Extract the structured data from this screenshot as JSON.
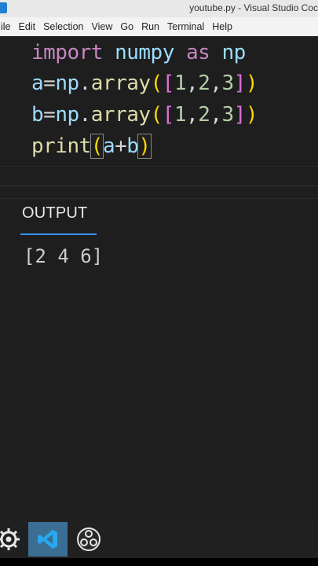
{
  "window": {
    "title": "youtube.py - Visual Studio Coc"
  },
  "menu": [
    {
      "label": "ile"
    },
    {
      "label": "Edit"
    },
    {
      "label": "Selection"
    },
    {
      "label": "View"
    },
    {
      "label": "Go"
    },
    {
      "label": "Run"
    },
    {
      "label": "Terminal"
    },
    {
      "label": "Help"
    }
  ],
  "editor": {
    "lines": [
      {
        "kw_import": "import",
        "mod": "numpy",
        "kw_as": "as",
        "alias": "np"
      },
      {
        "var": "a",
        "eq": "=",
        "np": "np",
        "dot": ".",
        "fn": "array",
        "p_open": "(",
        "b_open": "[",
        "n1": "1",
        "c1": ",",
        "n2": "2",
        "c2": ",",
        "n3": "3",
        "b_close": "]",
        "p_close": ")"
      },
      {
        "var": "b",
        "eq": "=",
        "np": "np",
        "dot": ".",
        "fn": "array",
        "p_open": "(",
        "b_open": "[",
        "n1": "1",
        "c1": ",",
        "n2": "2",
        "c2": ",",
        "n3": "3",
        "b_close": "]",
        "p_close": ")"
      },
      {
        "fn": "print",
        "p_open": "(",
        "a": "a",
        "plus": "+",
        "b": "b",
        "p_close": ")"
      }
    ]
  },
  "panel": {
    "tab": "OUTPUT",
    "output": "[2 4 6]"
  },
  "taskbar": {
    "icons": [
      "settings-gear-icon",
      "vscode-icon",
      "obs-icon"
    ]
  },
  "colors": {
    "accent": "#3794ff",
    "taskbar_active": "#3c6e94"
  }
}
